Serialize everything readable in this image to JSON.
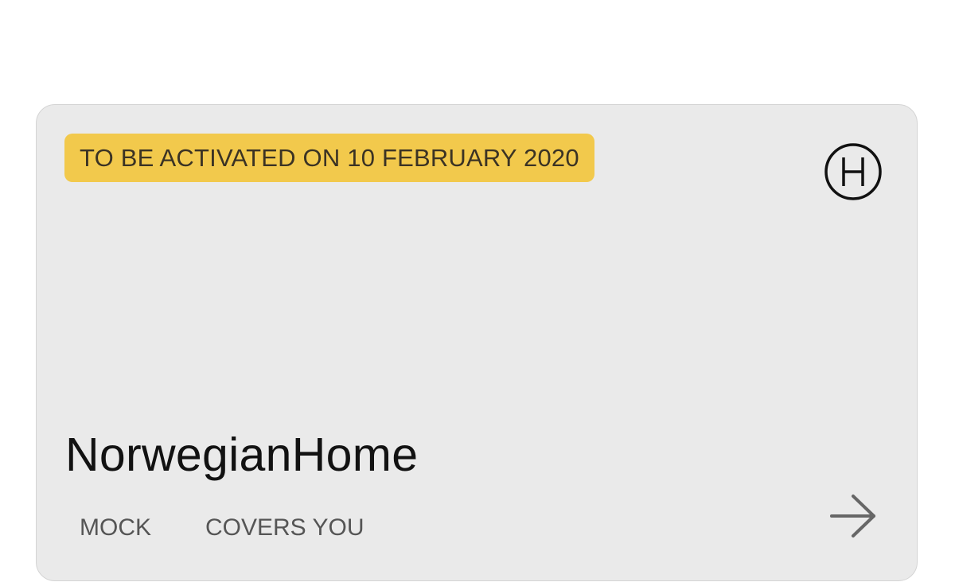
{
  "card": {
    "status_badge": "TO BE ACTIVATED ON 10 FEBRUARY 2020",
    "logo_icon": "circled-h-logo-icon",
    "product_name": "NorwegianHome",
    "tags": [
      "MOCK",
      "COVERS YOU"
    ],
    "arrow_icon": "arrow-right-icon"
  },
  "colors": {
    "card_background": "#eaeaea",
    "badge_background": "#f2c94c",
    "badge_text": "#3b3324",
    "title_text": "#121212",
    "tag_text": "#555555",
    "arrow": "#666666"
  }
}
